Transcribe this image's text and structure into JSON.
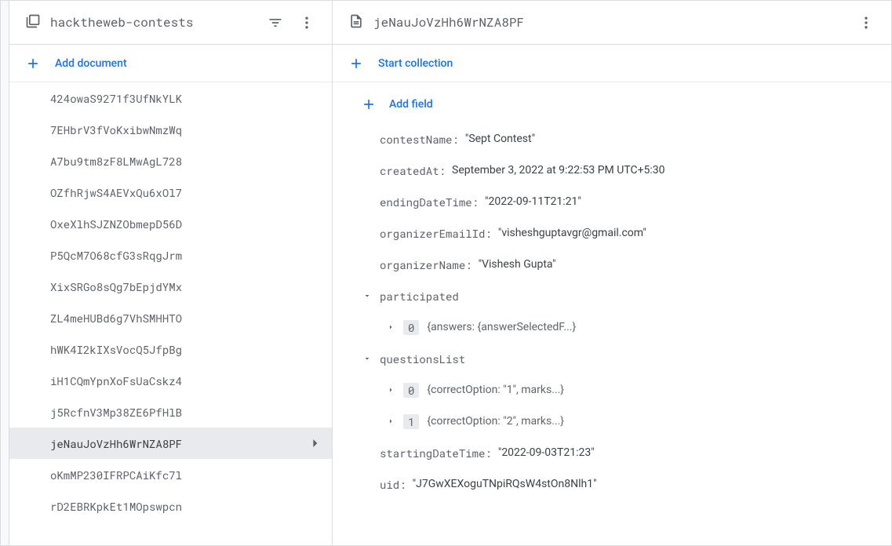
{
  "left": {
    "title": "hacktheweb-contests",
    "add_label": "Add document",
    "docs": [
      "424owaS9271f3UfNkYLK",
      "7EHbrV3fVoKxibwNmzWq",
      "A7bu9tm8zF8LMwAgL728",
      "OZfhRjwS4AEVxQu6xOl7",
      "OxeXlhSJZNZObmepD56D",
      "P5QcM7O68cfG3sRqgJrm",
      "XixSRGo8sQg7bEpjdYMx",
      "ZL4meHUBd6g7VhSMHHTO",
      "hWK4I2kIXsVocQ5JfpBg",
      "iH1CQmYpnXoFsUaCskz4",
      "j5RcfnV3Mp38ZE6PfHlB",
      "jeNauJoVzHh6WrNZA8PF",
      "oKmMP230IFRPCAiKfc7l",
      "rD2EBRKpkEt1MOpswpcn"
    ],
    "selected_index": 11
  },
  "right": {
    "title": "jeNauJoVzHh6WrNZA8PF",
    "start_collection_label": "Start collection",
    "add_field_label": "Add field",
    "fields": {
      "contestName": {
        "key": "contestName",
        "value": "\"Sept Contest\""
      },
      "createdAt": {
        "key": "createdAt",
        "value": "September 3, 2022 at 9:22:53 PM UTC+5:30"
      },
      "endingDateTime": {
        "key": "endingDateTime",
        "value": "\"2022-09-11T21:21\""
      },
      "organizerEmailId": {
        "key": "organizerEmailId",
        "value": "\"visheshguptavgr@gmail.com\""
      },
      "organizerName": {
        "key": "organizerName",
        "value": "\"Vishesh Gupta\""
      },
      "participated": {
        "key": "participated"
      },
      "participated_0": {
        "index": "0",
        "preview": "{answers: {answerSelectedF...}"
      },
      "questionsList": {
        "key": "questionsList"
      },
      "questionsList_0": {
        "index": "0",
        "preview": "{correctOption: \"1\", marks...}"
      },
      "questionsList_1": {
        "index": "1",
        "preview": "{correctOption: \"2\", marks...}"
      },
      "startingDateTime": {
        "key": "startingDateTime",
        "value": "\"2022-09-03T21:23\""
      },
      "uid": {
        "key": "uid",
        "value": "\"J7GwXEXoguTNpiRQsW4stOn8Nlh1\""
      }
    }
  }
}
